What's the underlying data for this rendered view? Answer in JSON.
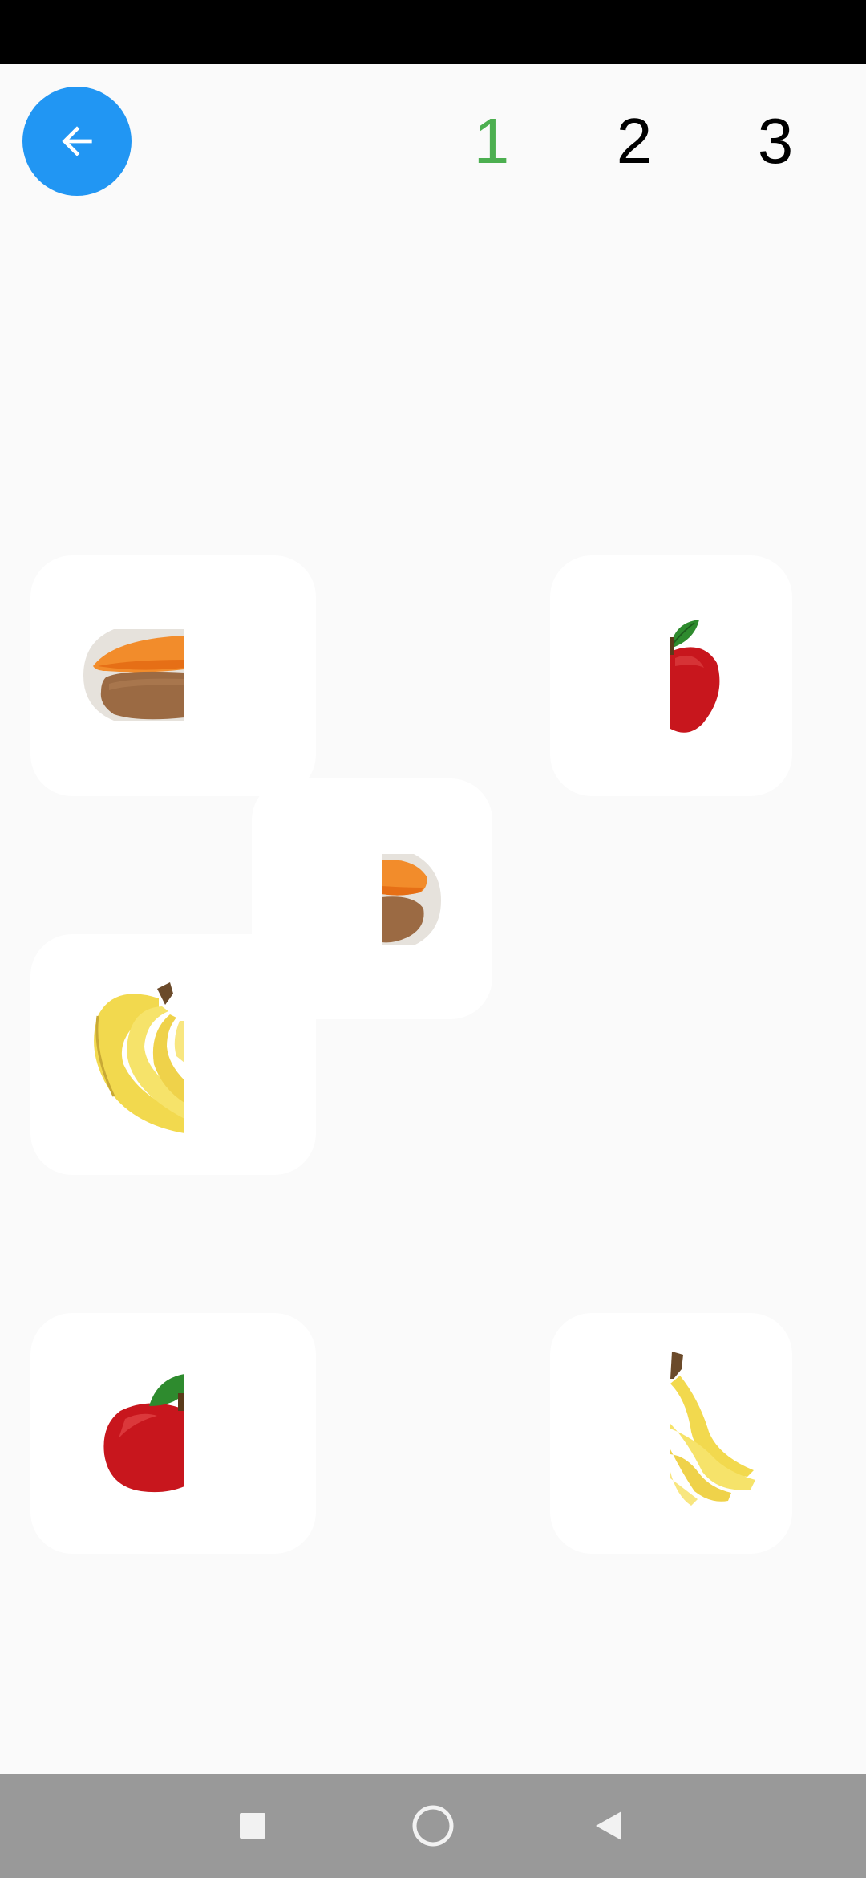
{
  "header": {
    "back_icon": "arrow-left-icon",
    "levels": [
      {
        "label": "1",
        "color": "#4caf50",
        "state": "current"
      },
      {
        "label": "2",
        "color": "#000000",
        "state": "locked"
      },
      {
        "label": "3",
        "color": "#000000",
        "state": "locked"
      }
    ]
  },
  "puzzle": {
    "pieces": [
      {
        "fruit": "sweet-potato",
        "half": "left"
      },
      {
        "fruit": "apple",
        "half": "right"
      },
      {
        "fruit": "sweet-potato",
        "half": "right"
      },
      {
        "fruit": "banana",
        "half": "left"
      },
      {
        "fruit": "apple",
        "half": "left"
      },
      {
        "fruit": "banana",
        "half": "right"
      }
    ]
  },
  "colors": {
    "accent": "#2196f3",
    "current_level": "#4caf50",
    "background": "#fafafa",
    "nav_bar": "#999999"
  },
  "system_nav": {
    "icons": [
      "recents-square-icon",
      "home-circle-icon",
      "back-triangle-icon"
    ]
  }
}
